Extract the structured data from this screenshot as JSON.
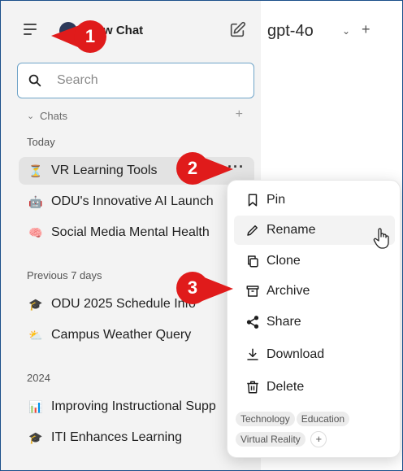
{
  "sidebar": {
    "new_chat_label": "w Chat",
    "search_placeholder": "Search",
    "chats_label": "Chats",
    "chats_add": "+",
    "sections": [
      {
        "label": "Today",
        "items": [
          {
            "emoji": "⏳",
            "title": "VR Learning Tools",
            "active": true
          },
          {
            "emoji": "🤖",
            "title": "ODU's Innovative AI Launch"
          },
          {
            "emoji": "🧠",
            "title": "Social Media Mental Health"
          }
        ]
      },
      {
        "label": "Previous 7 days",
        "items": [
          {
            "emoji": "🎓",
            "title": "ODU 2025 Schedule Info"
          },
          {
            "emoji": "⛅",
            "title": "Campus Weather Query"
          }
        ]
      },
      {
        "label": "2024",
        "items": [
          {
            "emoji": "📊",
            "title": "Improving Instructional Supp"
          },
          {
            "emoji": "🎓",
            "title": "ITI Enhances Learning"
          }
        ]
      }
    ],
    "more_dots": "···"
  },
  "main": {
    "model_name": "gpt-4o",
    "model_chevron": "⌄",
    "model_add": "+"
  },
  "menu": {
    "items": [
      {
        "label": "Pin",
        "icon": "bookmark-icon"
      },
      {
        "label": "Rename",
        "icon": "pencil-icon"
      },
      {
        "label": "Clone",
        "icon": "copy-icon"
      },
      {
        "label": "Archive",
        "icon": "archive-icon"
      },
      {
        "label": "Share",
        "icon": "share-icon"
      },
      {
        "label": "Download",
        "icon": "download-icon"
      },
      {
        "label": "Delete",
        "icon": "trash-icon"
      }
    ],
    "tags": [
      "Technology",
      "Education",
      "Virtual Reality"
    ],
    "tag_add": "+"
  },
  "callouts": [
    "1",
    "2",
    "3"
  ],
  "colors": {
    "callout": "#e01b1b",
    "sidebar_bg": "#f3f3f3",
    "search_border": "#6fa4c8",
    "frame_border": "#1b4f8a"
  }
}
